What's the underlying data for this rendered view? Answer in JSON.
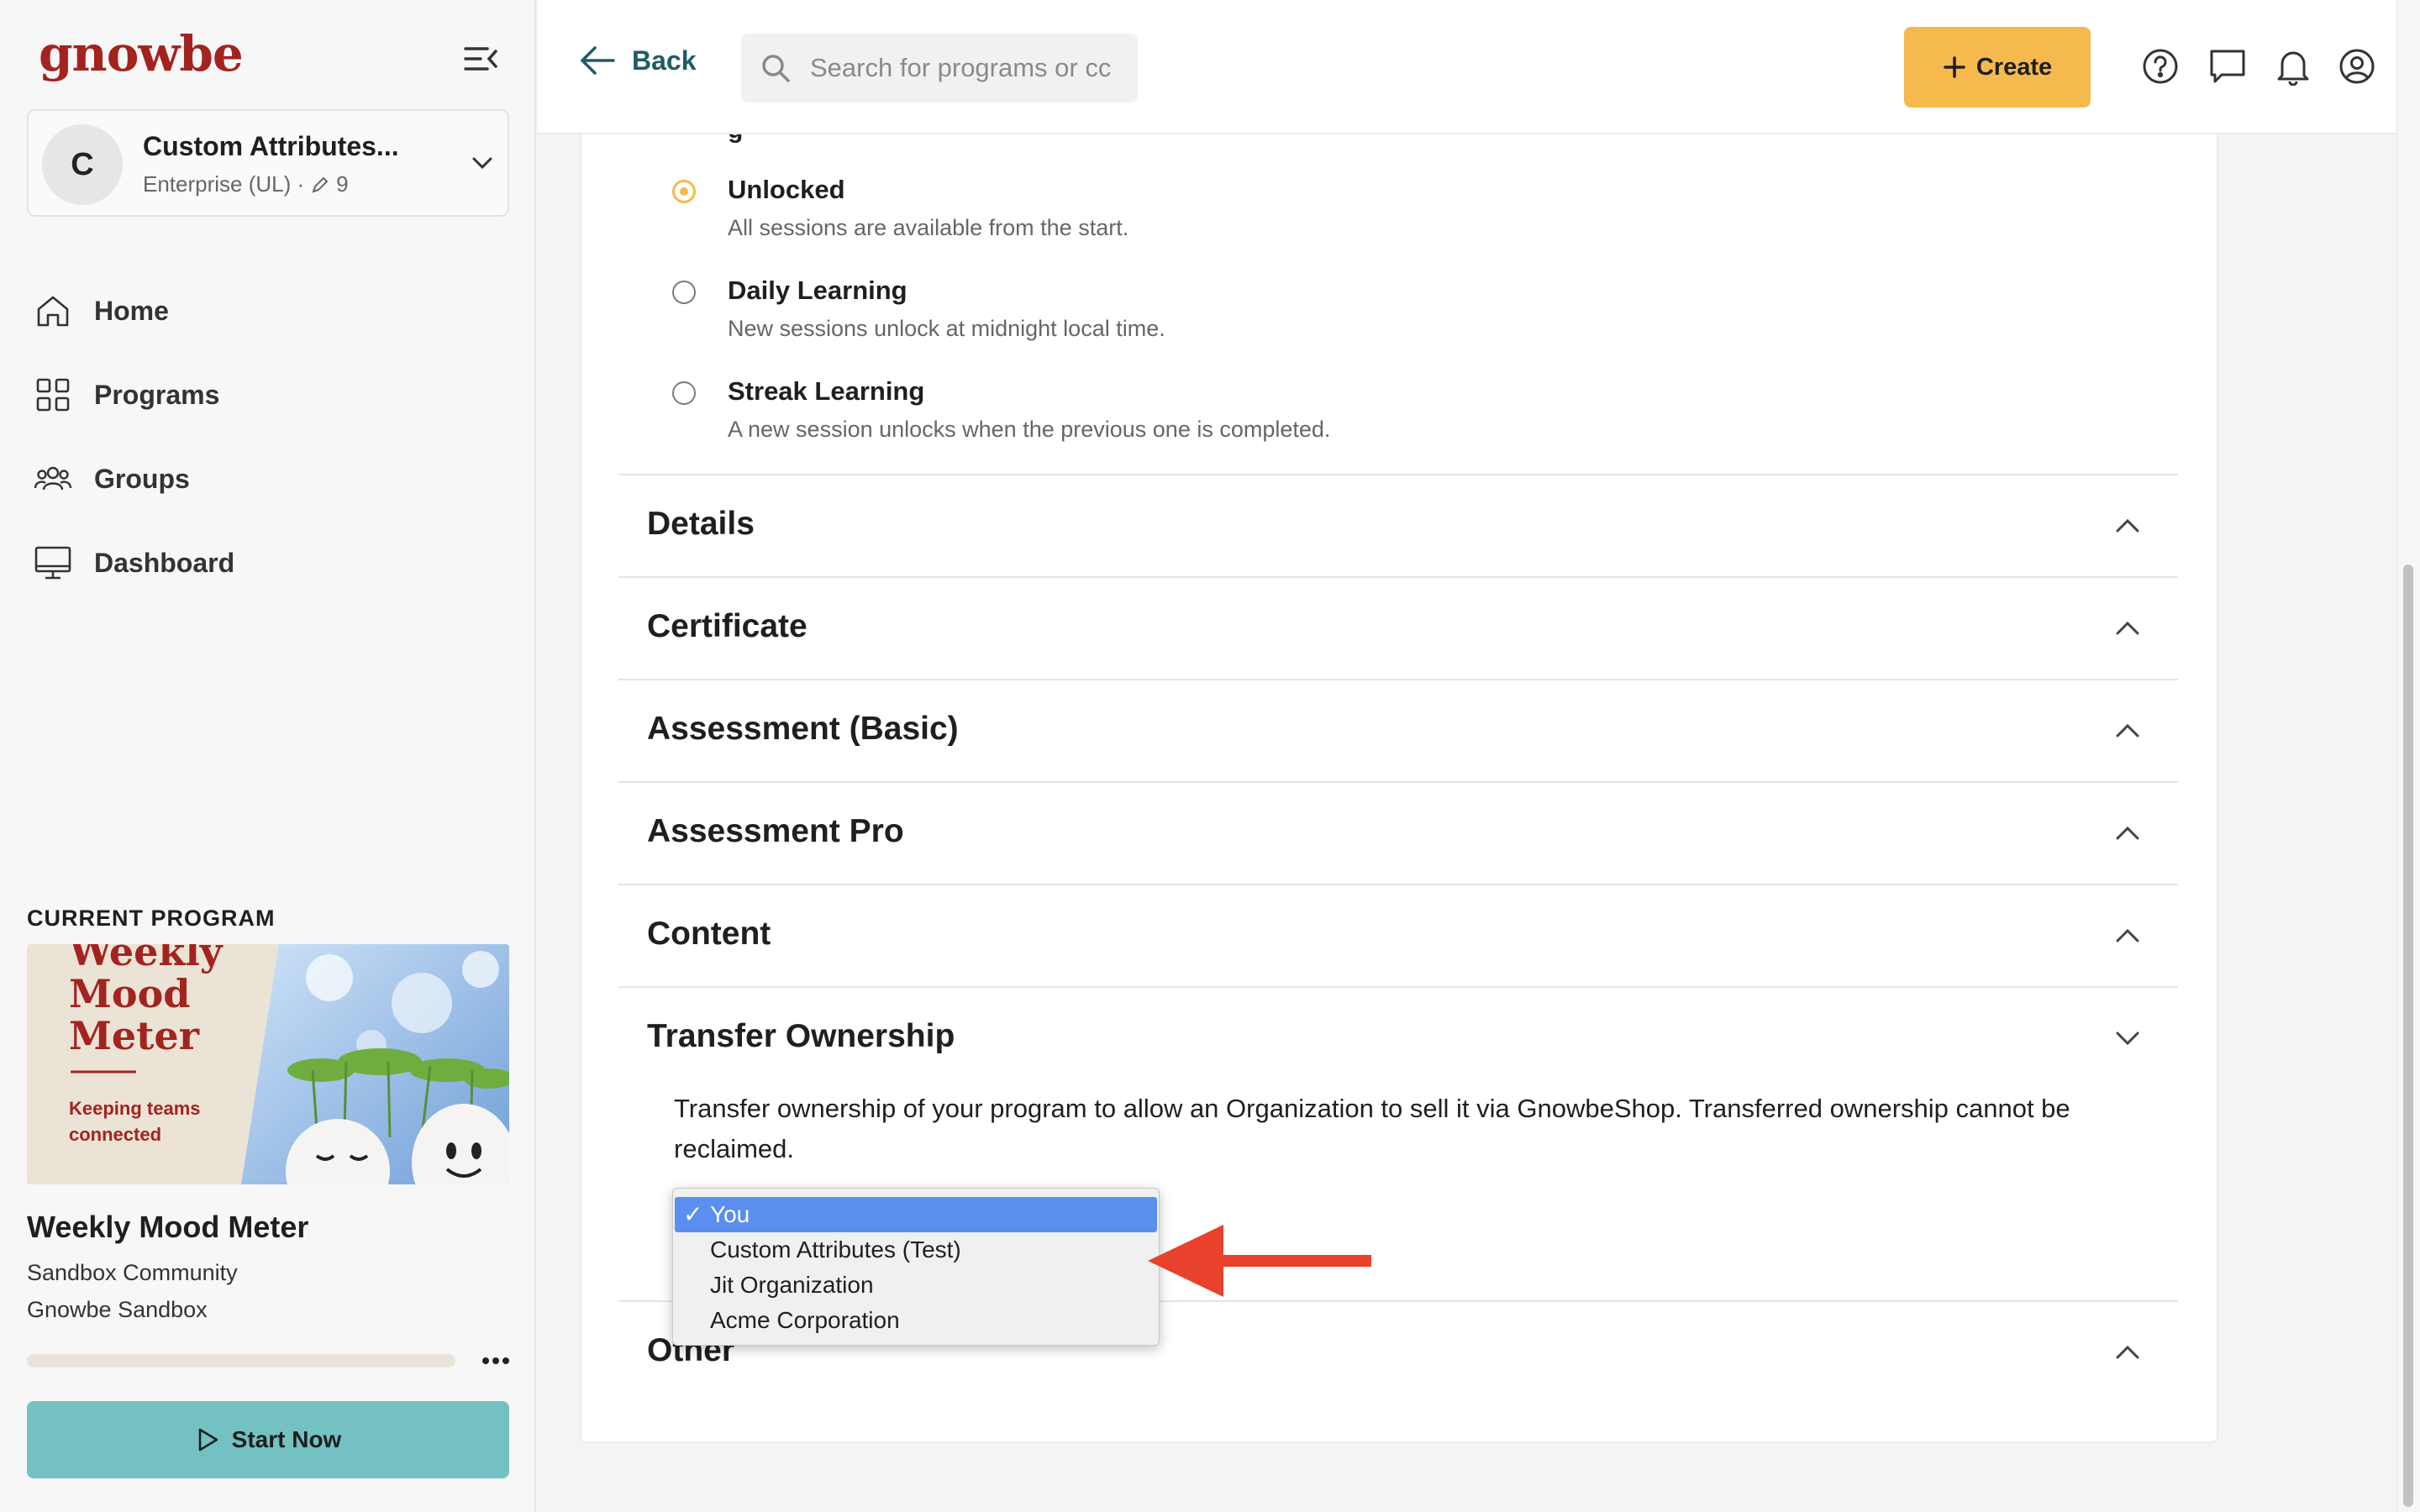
{
  "brand": {
    "logo_text": "gnowbe",
    "logo_color": "#a3231f"
  },
  "org": {
    "avatar_letter": "C",
    "name": "Custom Attributes...",
    "subtitle": "Enterprise (UL) ·",
    "edit_count": "9"
  },
  "nav": [
    {
      "label": "Home",
      "icon": "home-icon"
    },
    {
      "label": "Programs",
      "icon": "grid-icon"
    },
    {
      "label": "Groups",
      "icon": "people-icon"
    },
    {
      "label": "Dashboard",
      "icon": "monitor-icon"
    }
  ],
  "current_program": {
    "section_label": "CURRENT PROGRAM",
    "thumbnail_title": "Weekly Mood Meter",
    "thumbnail_title_lines": [
      "Weekly",
      "Mood",
      "Meter"
    ],
    "thumbnail_tagline_lines": [
      "Keeping teams",
      "connected"
    ],
    "title": "Weekly Mood Meter",
    "community": "Sandbox Community",
    "org": "Gnowbe Sandbox",
    "progress_fraction": 0.0,
    "start_label": "Start Now"
  },
  "topbar": {
    "back_label": "Back",
    "search_placeholder": "Search for programs or cc",
    "create_label": "Create",
    "icons": [
      "help-icon",
      "chat-icon",
      "bell-icon",
      "profile-icon"
    ]
  },
  "unlock_options": [
    {
      "title": "Unlocked",
      "desc": "All sessions are available from the start.",
      "selected": true
    },
    {
      "title": "Daily Learning",
      "desc": "New sessions unlock at midnight local time.",
      "selected": false
    },
    {
      "title": "Streak Learning",
      "desc": "A new session unlocks when the previous one is completed.",
      "selected": false
    }
  ],
  "sections": {
    "details": "Details",
    "certificate": "Certificate",
    "assessment_basic": "Assessment (Basic)",
    "assessment_pro": "Assessment Pro",
    "content": "Content",
    "transfer": "Transfer Ownership",
    "other": "Other"
  },
  "transfer": {
    "description": "Transfer ownership of your program to allow an Organization to sell it via GnowbeShop. Transferred ownership cannot be reclaimed.",
    "options": [
      {
        "label": "You",
        "selected": true
      },
      {
        "label": "Custom Attributes (Test)",
        "selected": false
      },
      {
        "label": "Jit Organization",
        "selected": false
      },
      {
        "label": "Acme Corporation",
        "selected": false
      }
    ],
    "check_mark": "✓"
  },
  "colors": {
    "accent_yellow": "#f5b94e",
    "teal_button": "#74c1c3",
    "back_text": "#1f5c63",
    "dropdown_selected": "#5a8ff0",
    "annotation_arrow": "#e8412c"
  }
}
